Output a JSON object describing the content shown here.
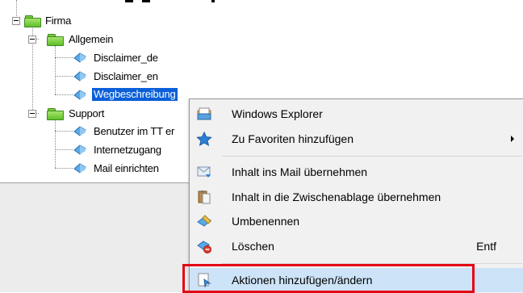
{
  "tree": {
    "nodes": [
      {
        "label": "Firma",
        "type": "folder",
        "level": 0
      },
      {
        "label": "Allgemein",
        "type": "folder",
        "level": 1
      },
      {
        "label": "Disclaimer_de",
        "type": "item",
        "level": 2
      },
      {
        "label": "Disclaimer_en",
        "type": "item",
        "level": 2
      },
      {
        "label": "Wegbeschreibung",
        "type": "item",
        "level": 2,
        "selected": true
      },
      {
        "label": "Support",
        "type": "folder",
        "level": 1
      },
      {
        "label": "Benutzer im TT er",
        "type": "item",
        "level": 2
      },
      {
        "label": "Internetzugang",
        "type": "item",
        "level": 2
      },
      {
        "label": "Mail einrichten",
        "type": "item",
        "level": 2
      }
    ]
  },
  "context_menu": {
    "items": [
      {
        "label": "Windows Explorer",
        "icon": "explorer-icon"
      },
      {
        "label": "Zu Favoriten hinzufügen",
        "icon": "star-icon",
        "submenu": true
      },
      {
        "label": "Inhalt ins Mail übernehmen",
        "icon": "mail-icon"
      },
      {
        "label": "Inhalt in die Zwischenablage übernehmen",
        "icon": "clipboard-icon"
      },
      {
        "label": "Umbenennen",
        "icon": "rename-icon"
      },
      {
        "label": "Löschen",
        "icon": "delete-icon",
        "shortcut": "Entf"
      },
      {
        "label": "Aktionen hinzufügen/ändern",
        "icon": "actions-icon",
        "highlighted": true
      }
    ]
  },
  "colors": {
    "selection": "#0a5fd8",
    "menu_highlight": "#cde3f7",
    "callout_border": "#e30613",
    "folder_green": "#5fbf2a"
  }
}
